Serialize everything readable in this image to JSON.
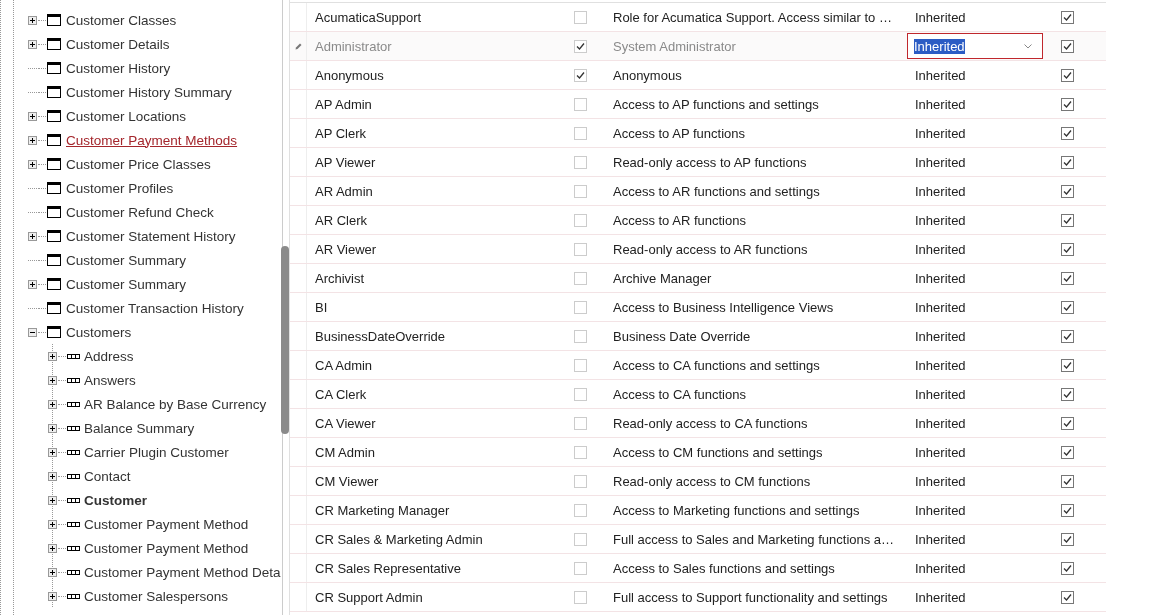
{
  "tree": {
    "items": [
      {
        "label": "Customer Classes",
        "kind": "group",
        "expanded": false,
        "selected": false
      },
      {
        "label": "Customer Details",
        "kind": "group",
        "expanded": false,
        "selected": false
      },
      {
        "label": "Customer History",
        "kind": "leaf",
        "selected": false
      },
      {
        "label": "Customer History Summary",
        "kind": "leaf",
        "selected": false
      },
      {
        "label": "Customer Locations",
        "kind": "group",
        "expanded": false,
        "selected": false
      },
      {
        "label": "Customer Payment Methods",
        "kind": "group",
        "expanded": false,
        "selected": true
      },
      {
        "label": "Customer Price Classes",
        "kind": "group",
        "expanded": false,
        "selected": false
      },
      {
        "label": "Customer Profiles",
        "kind": "leaf",
        "selected": false
      },
      {
        "label": "Customer Refund Check",
        "kind": "leaf",
        "selected": false
      },
      {
        "label": "Customer Statement History",
        "kind": "group",
        "expanded": false,
        "selected": false
      },
      {
        "label": "Customer Summary",
        "kind": "leaf",
        "selected": false
      },
      {
        "label": "Customer Summary",
        "kind": "group",
        "expanded": false,
        "selected": false
      },
      {
        "label": "Customer Transaction History",
        "kind": "leaf",
        "selected": false
      },
      {
        "label": "Customers",
        "kind": "group",
        "expanded": true,
        "selected": false,
        "children": [
          {
            "label": "Address",
            "kind": "group",
            "expanded": false,
            "emphasized": false
          },
          {
            "label": "Answers",
            "kind": "group",
            "expanded": false,
            "emphasized": false
          },
          {
            "label": "AR Balance by Base Currency",
            "kind": "group",
            "expanded": false,
            "emphasized": false
          },
          {
            "label": "Balance Summary",
            "kind": "group",
            "expanded": false,
            "emphasized": false
          },
          {
            "label": "Carrier Plugin Customer",
            "kind": "group",
            "expanded": false,
            "emphasized": false
          },
          {
            "label": "Contact",
            "kind": "group",
            "expanded": false,
            "emphasized": false
          },
          {
            "label": "Customer",
            "kind": "group",
            "expanded": false,
            "emphasized": true
          },
          {
            "label": "Customer Payment Method",
            "kind": "group",
            "expanded": false,
            "emphasized": false
          },
          {
            "label": "Customer Payment Method",
            "kind": "group",
            "expanded": false,
            "emphasized": false
          },
          {
            "label": "Customer Payment Method Deta",
            "kind": "group",
            "expanded": false,
            "emphasized": false
          },
          {
            "label": "Customer Salespersons",
            "kind": "group",
            "expanded": false,
            "emphasized": false
          }
        ]
      }
    ]
  },
  "grid": {
    "rows": [
      {
        "name": "AcumaticaSupport",
        "checked": false,
        "description": "Role for Acumatica Support. Access similar to …",
        "status": "Inherited",
        "included": true,
        "selected": false
      },
      {
        "name": "Administrator",
        "checked": true,
        "description": "System Administrator",
        "status": "Inherited",
        "included": true,
        "selected": true
      },
      {
        "name": "Anonymous",
        "checked": true,
        "description": "Anonymous",
        "status": "Inherited",
        "included": true,
        "selected": false
      },
      {
        "name": "AP Admin",
        "checked": false,
        "description": "Access to AP functions and settings",
        "status": "Inherited",
        "included": true,
        "selected": false
      },
      {
        "name": "AP Clerk",
        "checked": false,
        "description": "Access to AP functions",
        "status": "Inherited",
        "included": true,
        "selected": false
      },
      {
        "name": "AP Viewer",
        "checked": false,
        "description": "Read-only access to AP functions",
        "status": "Inherited",
        "included": true,
        "selected": false
      },
      {
        "name": "AR Admin",
        "checked": false,
        "description": "Access to AR functions and settings",
        "status": "Inherited",
        "included": true,
        "selected": false
      },
      {
        "name": "AR Clerk",
        "checked": false,
        "description": "Access to AR functions",
        "status": "Inherited",
        "included": true,
        "selected": false
      },
      {
        "name": "AR Viewer",
        "checked": false,
        "description": "Read-only access to AR functions",
        "status": "Inherited",
        "included": true,
        "selected": false
      },
      {
        "name": "Archivist",
        "checked": false,
        "description": "Archive Manager",
        "status": "Inherited",
        "included": true,
        "selected": false
      },
      {
        "name": "BI",
        "checked": false,
        "description": "Access to Business Intelligence Views",
        "status": "Inherited",
        "included": true,
        "selected": false
      },
      {
        "name": "BusinessDateOverride",
        "checked": false,
        "description": "Business Date Override",
        "status": "Inherited",
        "included": true,
        "selected": false
      },
      {
        "name": "CA Admin",
        "checked": false,
        "description": "Access to CA functions and settings",
        "status": "Inherited",
        "included": true,
        "selected": false
      },
      {
        "name": "CA Clerk",
        "checked": false,
        "description": "Access to CA functions",
        "status": "Inherited",
        "included": true,
        "selected": false
      },
      {
        "name": "CA Viewer",
        "checked": false,
        "description": "Read-only access to CA functions",
        "status": "Inherited",
        "included": true,
        "selected": false
      },
      {
        "name": "CM Admin",
        "checked": false,
        "description": "Access to CM functions and settings",
        "status": "Inherited",
        "included": true,
        "selected": false
      },
      {
        "name": "CM Viewer",
        "checked": false,
        "description": "Read-only access to CM functions",
        "status": "Inherited",
        "included": true,
        "selected": false
      },
      {
        "name": "CR Marketing Manager",
        "checked": false,
        "description": "Access to Marketing functions and settings",
        "status": "Inherited",
        "included": true,
        "selected": false
      },
      {
        "name": "CR Sales & Marketing Admin",
        "checked": false,
        "description": "Full access to Sales and Marketing functions a…",
        "status": "Inherited",
        "included": true,
        "selected": false
      },
      {
        "name": "CR Sales Representative",
        "checked": false,
        "description": "Access to Sales functions and settings",
        "status": "Inherited",
        "included": true,
        "selected": false
      },
      {
        "name": "CR Support Admin",
        "checked": false,
        "description": "Full access to Support functionality and settings",
        "status": "Inherited",
        "included": true,
        "selected": false
      }
    ]
  }
}
